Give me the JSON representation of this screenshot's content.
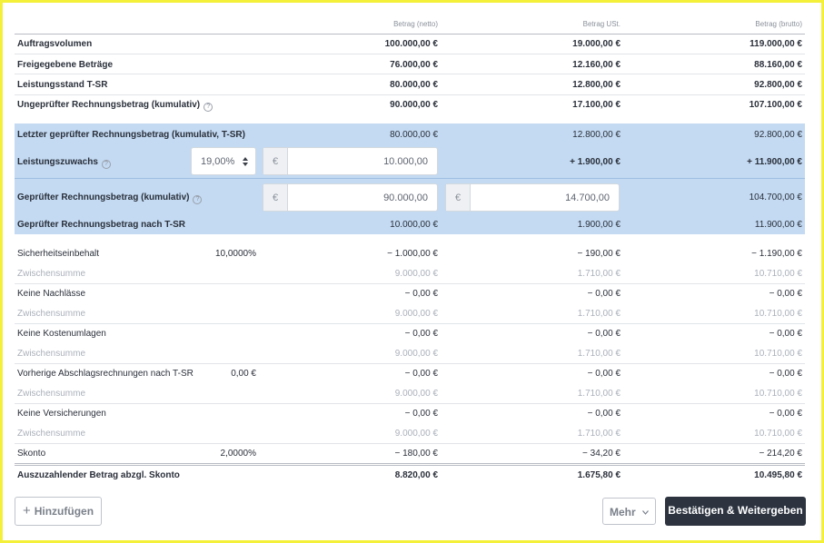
{
  "columns": {
    "netto": "Betrag (netto)",
    "ust": "Betrag USt.",
    "brutto": "Betrag (brutto)"
  },
  "summary": [
    {
      "label": "Auftragsvolumen",
      "netto": "100.000,00 €",
      "ust": "19.000,00 €",
      "brutto": "119.000,00 €"
    },
    {
      "label": "Freigegebene Beträge",
      "netto": "76.000,00 €",
      "ust": "12.160,00 €",
      "brutto": "88.160,00 €"
    },
    {
      "label": "Leistungsstand T-SR",
      "netto": "80.000,00 €",
      "ust": "12.800,00 €",
      "brutto": "92.800,00 €"
    },
    {
      "label": "Ungeprüfter Rechnungsbetrag (kumulativ)",
      "netto": "90.000,00 €",
      "ust": "17.100,00 €",
      "brutto": "107.100,00 €"
    }
  ],
  "blue": {
    "last_checked": {
      "label": "Letzter geprüfter Rechnungsbetrag (kumulativ, T-SR)",
      "netto": "80.000,00 €",
      "ust": "12.800,00 €",
      "brutto": "92.800,00 €"
    },
    "increase": {
      "label": "Leistungszuwachs",
      "percent": "19,00%",
      "currency": "€",
      "netto_input": "10.000,00",
      "ust": "+ 1.900,00 €",
      "brutto": "+ 11.900,00 €"
    },
    "checked_cumulative": {
      "label": "Geprüfter Rechnungsbetrag (kumulativ)",
      "currency": "€",
      "netto_input": "90.000,00",
      "ust_input": "14.700,00",
      "brutto": "104.700,00 €"
    },
    "checked_after": {
      "label": "Geprüfter Rechnungsbetrag nach T-SR",
      "netto": "10.000,00 €",
      "ust": "1.900,00 €",
      "brutto": "11.900,00 €"
    }
  },
  "deductions": [
    {
      "label": "Sicherheitseinbehalt",
      "mid": "10,0000%",
      "netto": "− 1.000,00 €",
      "ust": "− 190,00 €",
      "brutto": "− 1.190,00 €",
      "sub": {
        "label": "Zwischensumme",
        "netto": "9.000,00 €",
        "ust": "1.710,00 €",
        "brutto": "10.710,00 €"
      }
    },
    {
      "label": "Keine Nachlässe",
      "mid": "",
      "netto": "− 0,00 €",
      "ust": "− 0,00 €",
      "brutto": "− 0,00 €",
      "sub": {
        "label": "Zwischensumme",
        "netto": "9.000,00 €",
        "ust": "1.710,00 €",
        "brutto": "10.710,00 €"
      }
    },
    {
      "label": "Keine Kostenumlagen",
      "mid": "",
      "netto": "− 0,00 €",
      "ust": "− 0,00 €",
      "brutto": "− 0,00 €",
      "sub": {
        "label": "Zwischensumme",
        "netto": "9.000,00 €",
        "ust": "1.710,00 €",
        "brutto": "10.710,00 €"
      }
    },
    {
      "label": "Vorherige Abschlagsrechnungen nach T-SR",
      "mid": "0,00 €",
      "netto": "− 0,00 €",
      "ust": "− 0,00 €",
      "brutto": "− 0,00 €",
      "sub": {
        "label": "Zwischensumme",
        "netto": "9.000,00 €",
        "ust": "1.710,00 €",
        "brutto": "10.710,00 €"
      }
    },
    {
      "label": "Keine Versicherungen",
      "mid": "",
      "netto": "− 0,00 €",
      "ust": "− 0,00 €",
      "brutto": "− 0,00 €",
      "sub": {
        "label": "Zwischensumme",
        "netto": "9.000,00 €",
        "ust": "1.710,00 €",
        "brutto": "10.710,00 €"
      }
    }
  ],
  "skonto": {
    "label": "Skonto",
    "mid": "2,0000%",
    "netto": "− 180,00 €",
    "ust": "− 34,20 €",
    "brutto": "− 214,20 €"
  },
  "total": {
    "label": "Auszuzahlender Betrag abzgl. Skonto",
    "netto": "8.820,00 €",
    "ust": "1.675,80 €",
    "brutto": "10.495,80 €"
  },
  "buttons": {
    "add": "Hinzufügen",
    "more": "Mehr",
    "confirm": "Bestätigen & Weitergeben"
  }
}
